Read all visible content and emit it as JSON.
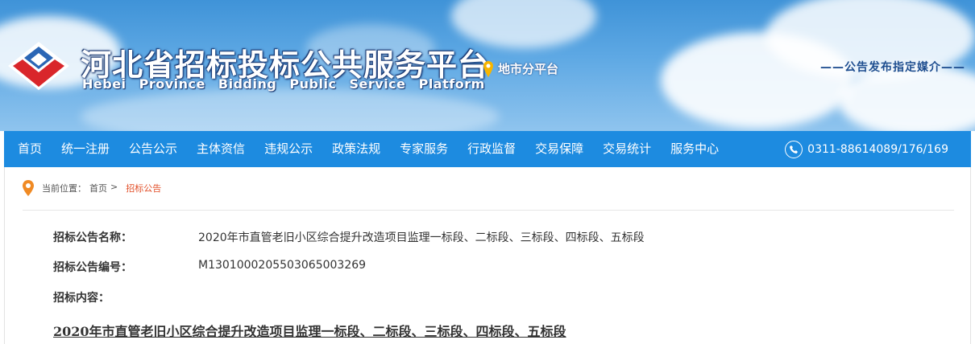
{
  "header": {
    "title": "河北省招标投标公共服务平台",
    "subtitle": "Hebei Province Bidding Public Service Platform",
    "city_link": "地市分平台",
    "tagline": "——公告发布指定媒介——",
    "logo_icon": "hebei-logo-icon",
    "pin_icon": "location-pin-icon"
  },
  "nav": {
    "items": [
      "首页",
      "统一注册",
      "公告公示",
      "主体资信",
      "违规公示",
      "政策法规",
      "专家服务",
      "行政监督",
      "交易保障",
      "交易统计",
      "服务中心"
    ],
    "phone": "0311-88614089/176/169",
    "phone_icon": "phone-icon",
    "background": "#1d8be0"
  },
  "breadcrumb": {
    "prefix": "当前位置：",
    "home": "首页",
    "separator": ">",
    "current": "招标公告"
  },
  "announcement": {
    "name_label": "招标公告名称：",
    "name_value": "2020年市直管老旧小区综合提升改造项目监理一标段、二标段、三标段、四标段、五标段",
    "number_label": "招标公告编号：",
    "number_value": "M1301000205503065003269",
    "content_label": "招标内容：",
    "content_title": "2020年市直管老旧小区综合提升改造项目监理一标段、二标段、三标段、四标段、五标段"
  }
}
